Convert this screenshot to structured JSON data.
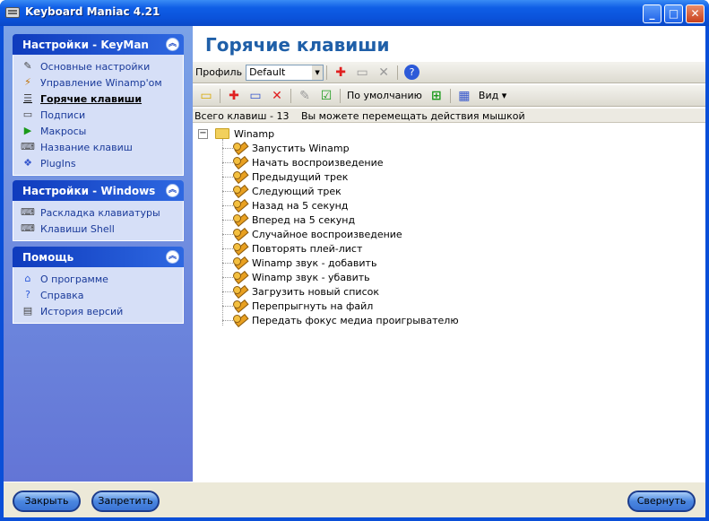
{
  "window": {
    "title": "Keyboard Maniac 4.21",
    "minimize": "_",
    "maximize": "□",
    "close": "✕"
  },
  "sidebar": {
    "panels": [
      {
        "title": "Настройки - KeyMan",
        "items": [
          {
            "label": "Основные настройки",
            "icon": "settings-icon"
          },
          {
            "label": "Управление Winamp'ом",
            "icon": "winamp-icon"
          },
          {
            "label": "Горячие клавиши",
            "icon": "hotkeys-icon",
            "active": true
          },
          {
            "label": "Подписи",
            "icon": "captions-icon"
          },
          {
            "label": "Макросы",
            "icon": "macros-icon"
          },
          {
            "label": "Название клавиш",
            "icon": "keynames-icon"
          },
          {
            "label": "PlugIns",
            "icon": "plugins-icon"
          }
        ]
      },
      {
        "title": "Настройки - Windows",
        "items": [
          {
            "label": "Раскладка клавиатуры",
            "icon": "keyboard-layout-icon"
          },
          {
            "label": "Клавиши Shell",
            "icon": "shell-keys-icon"
          }
        ]
      },
      {
        "title": "Помощь",
        "items": [
          {
            "label": "О программе",
            "icon": "about-icon"
          },
          {
            "label": "Справка",
            "icon": "help-icon"
          },
          {
            "label": "История версий",
            "icon": "history-icon"
          }
        ]
      }
    ]
  },
  "main": {
    "title": "Горячие клавиши",
    "profile_label": "Профиль",
    "profile_value": "Default",
    "default_label": "По умолчанию",
    "view_label": "Вид",
    "status_count": "Всего клавиш - 13",
    "status_hint": "Вы можете перемещать действия мышкой",
    "tree_root": "Winamp",
    "tree_items": [
      "Запустить Winamp",
      "Начать воспроизведение",
      "Предыдущий трек",
      "Следующий трек",
      "Назад на 5 секунд",
      "Вперед на 5 секунд",
      "Случайное воспроизведение",
      "Повторять плей-лист",
      "Winamp звук - добавить",
      "Winamp звук - убавить",
      "Загрузить новый список",
      "Перепрыгнуть на файл",
      "Передать фокус медиа проигрывателю"
    ]
  },
  "bottom": {
    "close_label": "Закрыть",
    "disable_label": "Запретить",
    "minimize_label": "Свернуть"
  }
}
